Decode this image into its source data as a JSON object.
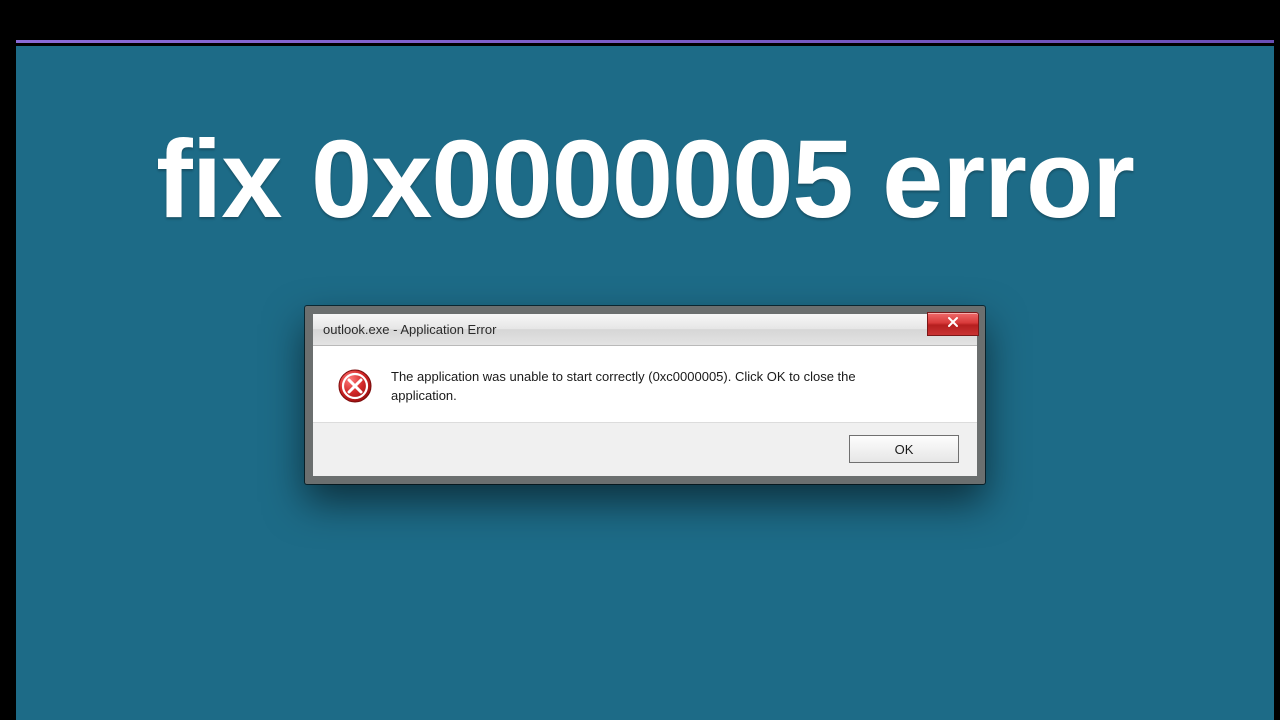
{
  "headline": "fix 0x0000005 error",
  "dialog": {
    "title": "outlook.exe - Application Error",
    "message": "The application was unable to start correctly (0xc0000005). Click OK to close the application.",
    "ok_label": "OK"
  },
  "colors": {
    "background_teal": "#1d6b87",
    "close_red": "#c93333"
  }
}
